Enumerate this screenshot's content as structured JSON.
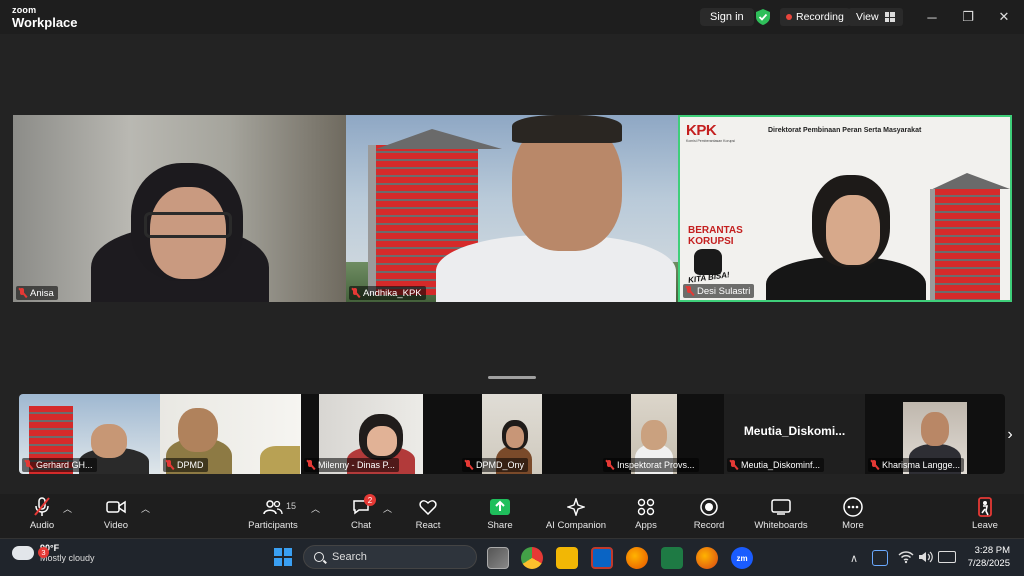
{
  "app": {
    "logo_line1": "zoom",
    "logo_line2": "Workplace",
    "sign_in": "Sign in",
    "recording": "Recording",
    "view": "View"
  },
  "window_controls": {
    "minimize": "─",
    "restore": "❐",
    "close": "✕"
  },
  "main_tiles": [
    {
      "name": "Anisa"
    },
    {
      "name": "Andhika_KPK"
    },
    {
      "name": "Desi Sulastri"
    }
  ],
  "slide": {
    "logo": "KPK",
    "logo_sub": "Komisi Pemberantasan Korupsi",
    "heading": "Direktorat Pembinaan Peran Serta Masyarakat",
    "slogan_1": "BERANTAS",
    "slogan_2": "KORUPSI",
    "slogan_3": "KITA BISA!"
  },
  "strip_tiles": [
    {
      "name": "Gerhard GH..."
    },
    {
      "name": "DPMD"
    },
    {
      "name": "Milenny - Dinas P..."
    },
    {
      "name": "DPMD_Ony"
    },
    {
      "name": "Inspektorat Provs..."
    },
    {
      "name": "Meutia_Diskominf...",
      "display_name": "Meutia_Diskomi..."
    },
    {
      "name": "Kharisma Langge..."
    }
  ],
  "toolbar": {
    "audio": "Audio",
    "video": "Video",
    "participants": "Participants",
    "participants_count": "15",
    "chat": "Chat",
    "chat_badge": "2",
    "react": "React",
    "share": "Share",
    "ai_companion": "AI Companion",
    "apps": "Apps",
    "record": "Record",
    "whiteboards": "Whiteboards",
    "more": "More",
    "leave": "Leave"
  },
  "taskbar": {
    "weather_badge": "3",
    "temperature": "90°F",
    "condition": "Mostly cloudy",
    "search_placeholder": "Search",
    "time": "3:28 PM",
    "date": "7/28/2025",
    "tray_chevron": "∧"
  },
  "colors": {
    "accent_green": "#3fcf7a",
    "muted_red": "#e53935",
    "share_green": "#1fbf5c",
    "leave_red": "#e53935",
    "kpk_red": "#d52a2a"
  }
}
